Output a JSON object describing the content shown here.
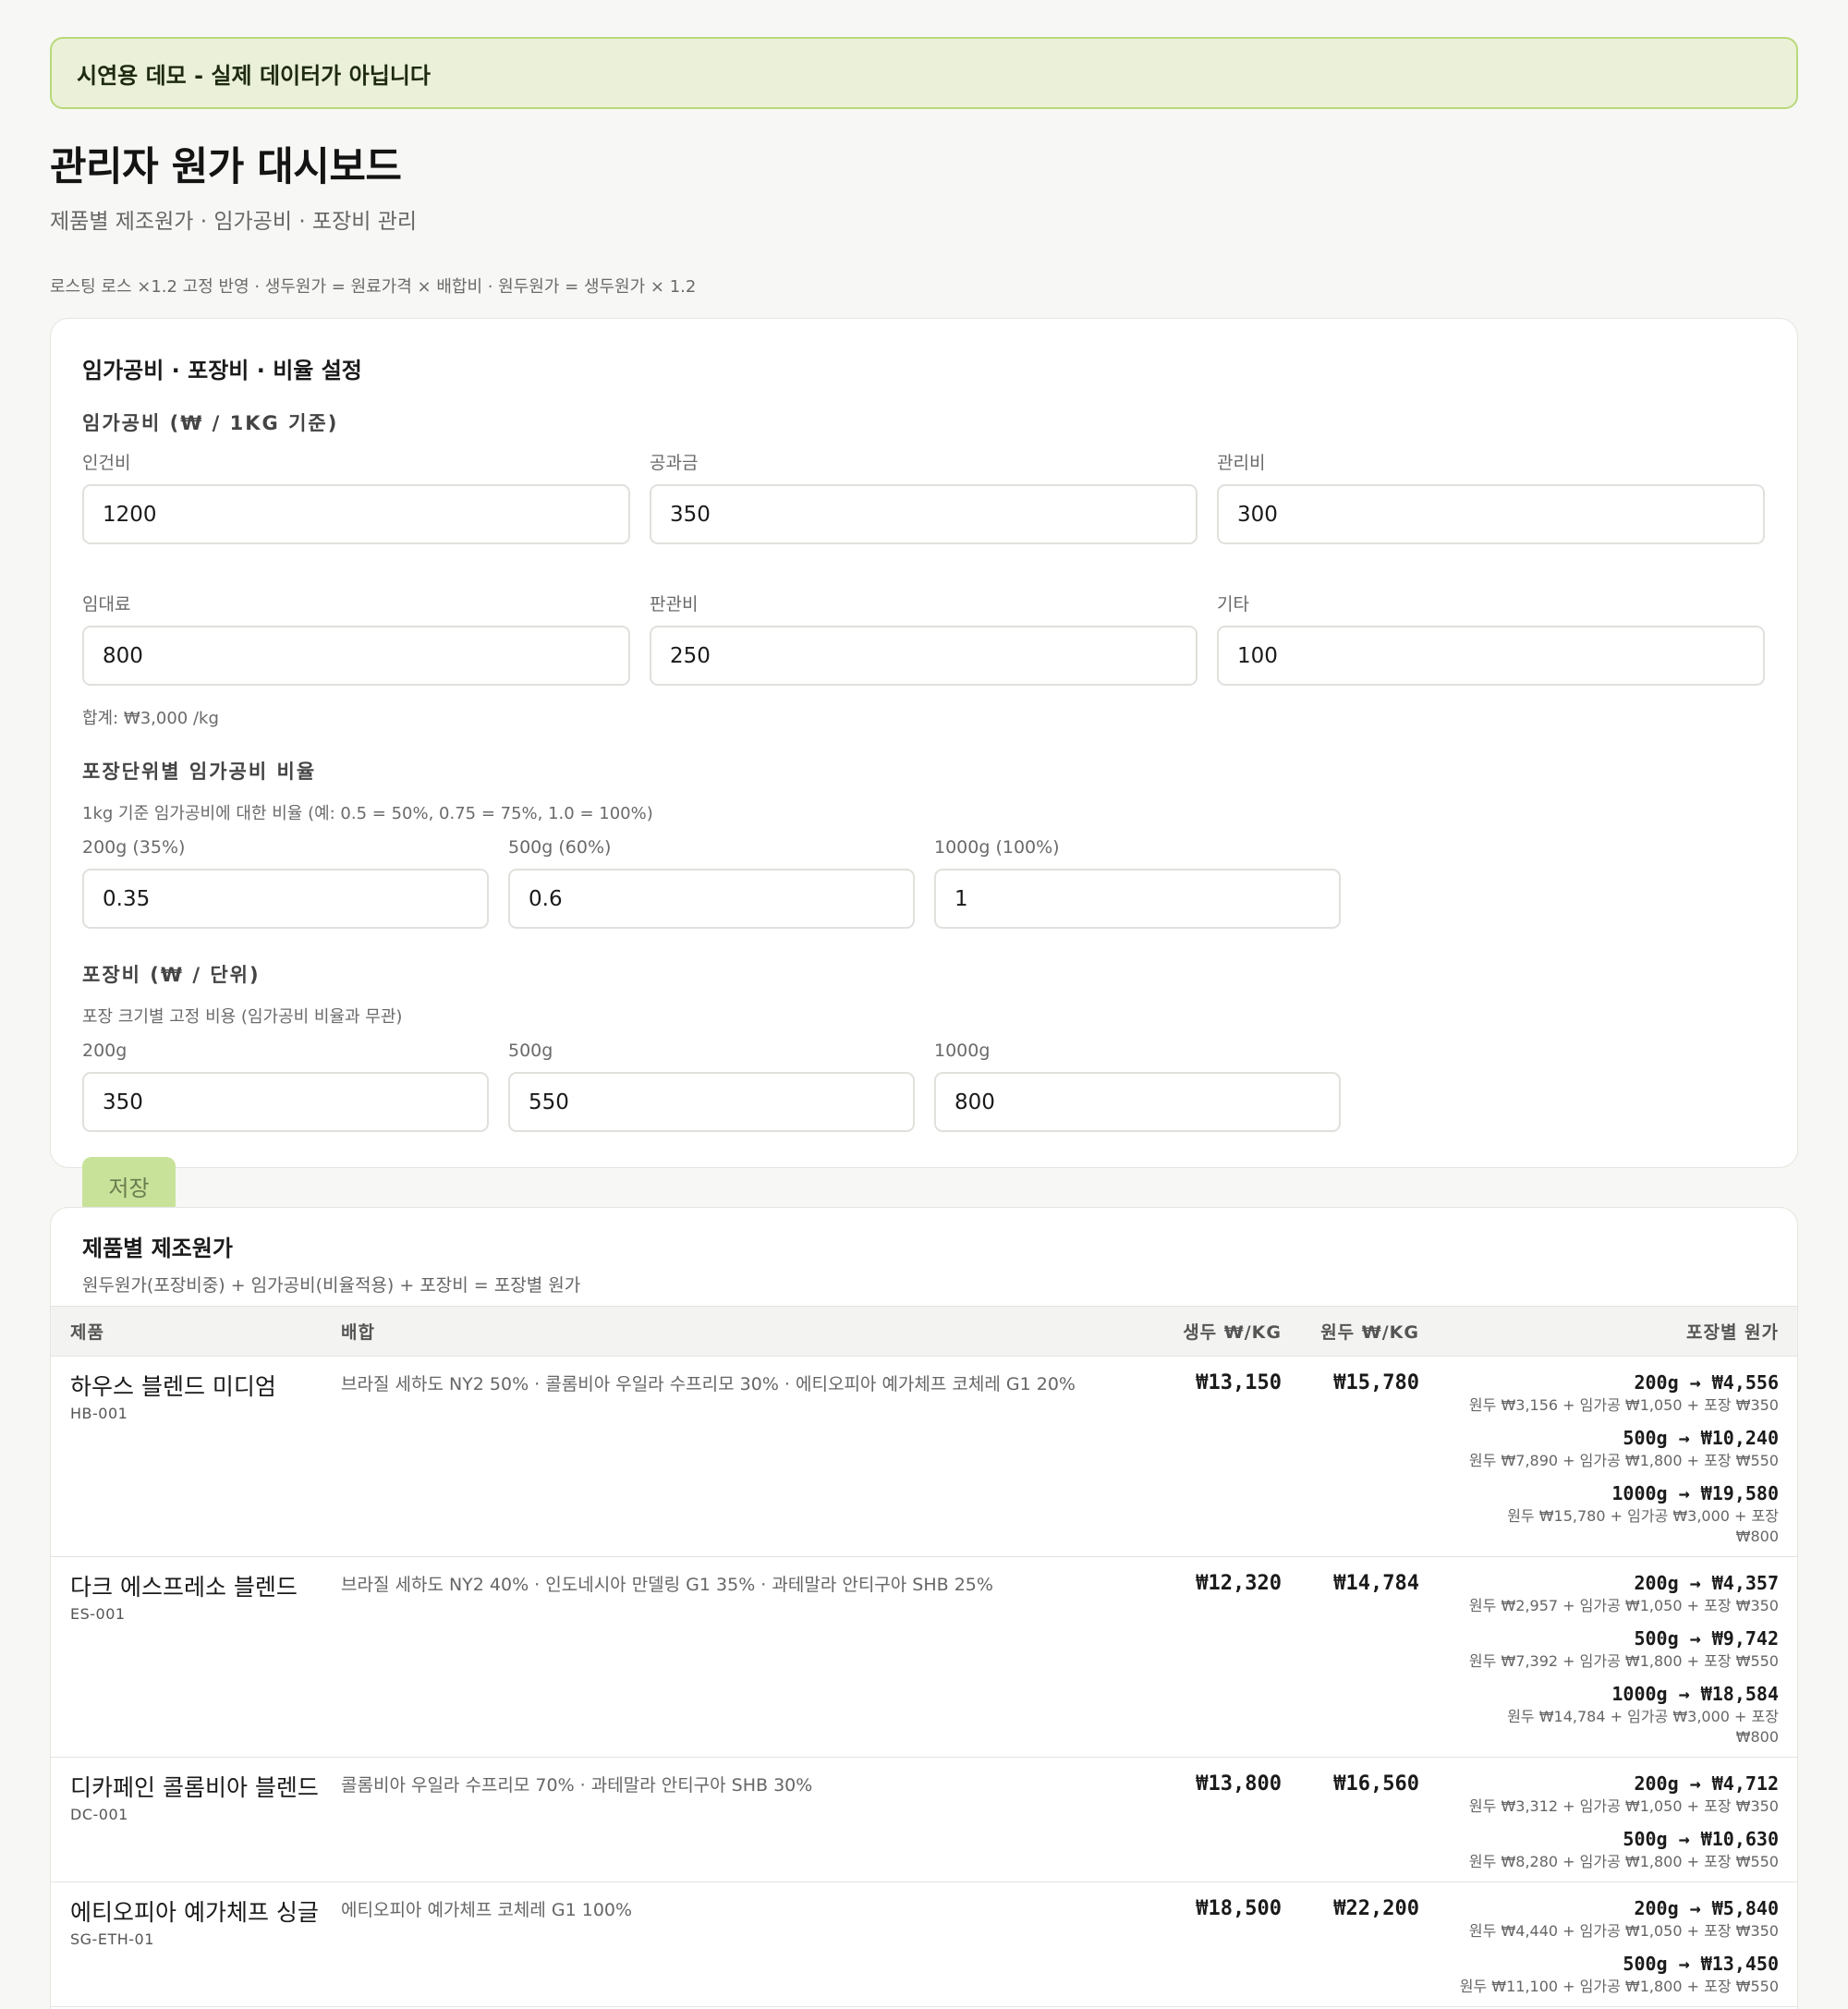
{
  "banner": {
    "text": "시연용 데모 - 실제 데이터가 아닙니다"
  },
  "header": {
    "title": "관리자 원가 대시보드",
    "subtitle": "제품별 제조원가 · 임가공비 · 포장비 관리",
    "formula_note": "로스팅 로스 ×1.2 고정 반영 · 생두원가 = 원료가격 × 배합비 · 원두원가 = 생두원가 × 1.2"
  },
  "settings": {
    "title": "임가공비 · 포장비 · 비율 설정",
    "overhead_label": "임가공비 (₩ / 1KG 기준)",
    "fields": [
      {
        "label": "인건비",
        "value": "1200"
      },
      {
        "label": "공과금",
        "value": "350"
      },
      {
        "label": "관리비",
        "value": "300"
      },
      {
        "label": "임대료",
        "value": "800"
      },
      {
        "label": "판관비",
        "value": "250"
      },
      {
        "label": "기타",
        "value": "100"
      }
    ],
    "total": "합계: ₩3,000 /kg",
    "ratio_label": "포장단위별 임가공비 비율",
    "ratio_help": "1kg 기준 임가공비에 대한 비율 (예: 0.5 = 50%, 0.75 = 75%, 1.0 = 100%)",
    "ratios": [
      {
        "label": "200g (35%)",
        "value": "0.35"
      },
      {
        "label": "500g (60%)",
        "value": "0.6"
      },
      {
        "label": "1000g (100%)",
        "value": "1"
      }
    ],
    "packing_label": "포장비 (₩ / 단위)",
    "packing_help": "포장 크기별 고정 비용 (임가공비 비율과 무관)",
    "packing": [
      {
        "label": "200g",
        "value": "350"
      },
      {
        "label": "500g",
        "value": "550"
      },
      {
        "label": "1000g",
        "value": "800"
      }
    ],
    "save_label": "저장"
  },
  "products": {
    "title": "제품별 제조원가",
    "subtitle": "원두원가(포장비중) + 임가공비(비율적용) + 포장비 = 포장별 원가",
    "columns": [
      "제품",
      "배합",
      "생두 ₩/KG",
      "원두 ₩/KG",
      "포장별 원가"
    ],
    "rows": [
      {
        "name": "하우스 블렌드 미디엄",
        "code": "HB-001",
        "blend": "브라질 세하도 NY2 50% · 콜롬비아 우일라 수프리모 30% · 에티오피아 예가체프 코체레 G1 20%",
        "green": "₩13,150",
        "roasted": "₩15,780",
        "packages": [
          {
            "main": "200g → ₩4,556",
            "detail": "원두 ₩3,156 + 임가공 ₩1,050 + 포장 ₩350"
          },
          {
            "main": "500g → ₩10,240",
            "detail": "원두 ₩7,890 + 임가공 ₩1,800 + 포장 ₩550"
          },
          {
            "main": "1000g → ₩19,580",
            "detail": "원두 ₩15,780 + 임가공 ₩3,000 + 포장 ₩800"
          }
        ]
      },
      {
        "name": "다크 에스프레소 블렌드",
        "code": "ES-001",
        "blend": "브라질 세하도 NY2 40% · 인도네시아 만델링 G1 35% · 과테말라 안티구아 SHB 25%",
        "green": "₩12,320",
        "roasted": "₩14,784",
        "packages": [
          {
            "main": "200g → ₩4,357",
            "detail": "원두 ₩2,957 + 임가공 ₩1,050 + 포장 ₩350"
          },
          {
            "main": "500g → ₩9,742",
            "detail": "원두 ₩7,392 + 임가공 ₩1,800 + 포장 ₩550"
          },
          {
            "main": "1000g → ₩18,584",
            "detail": "원두 ₩14,784 + 임가공 ₩3,000 + 포장 ₩800"
          }
        ]
      },
      {
        "name": "디카페인 콜롬비아 블렌드",
        "code": "DC-001",
        "blend": "콜롬비아 우일라 수프리모 70% · 과테말라 안티구아 SHB 30%",
        "green": "₩13,800",
        "roasted": "₩16,560",
        "packages": [
          {
            "main": "200g → ₩4,712",
            "detail": "원두 ₩3,312 + 임가공 ₩1,050 + 포장 ₩350"
          },
          {
            "main": "500g → ₩10,630",
            "detail": "원두 ₩8,280 + 임가공 ₩1,800 + 포장 ₩550"
          }
        ]
      },
      {
        "name": "에티오피아 예가체프 싱글",
        "code": "SG-ETH-01",
        "blend": "에티오피아 예가체프 코체레 G1 100%",
        "green": "₩18,500",
        "roasted": "₩22,200",
        "packages": [
          {
            "main": "200g → ₩5,840",
            "detail": "원두 ₩4,440 + 임가공 ₩1,050 + 포장 ₩350"
          },
          {
            "main": "500g → ₩13,450",
            "detail": "원두 ₩11,100 + 임가공 ₩1,800 + 포장 ₩550"
          }
        ]
      }
    ]
  },
  "colors": {
    "banner_border": "#b9d97a",
    "banner_bg": "#eaf1d8",
    "save_button": "#c8e29a"
  }
}
